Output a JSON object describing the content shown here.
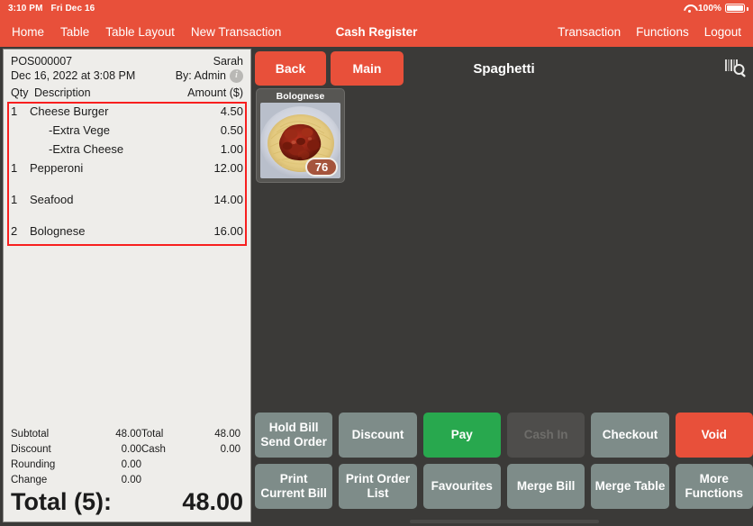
{
  "statusbar": {
    "time": "3:10 PM",
    "date": "Fri Dec 16",
    "battery_percent": "100%",
    "wifi_icon": "wifi-icon",
    "battery_icon": "battery-full-icon"
  },
  "nav": {
    "title": "Cash Register",
    "left_items": [
      {
        "label": "Home"
      },
      {
        "label": "Table"
      },
      {
        "label": "Table Layout"
      },
      {
        "label": "New Transaction"
      }
    ],
    "right_items": [
      {
        "label": "Transaction"
      },
      {
        "label": "Functions"
      },
      {
        "label": "Logout"
      }
    ]
  },
  "receipt": {
    "doc_no": "POS000007",
    "customer": "Sarah",
    "datetime": "Dec 16, 2022 at 3:08 PM",
    "by": "By: Admin",
    "info_icon": "info-icon",
    "col_qty": "Qty",
    "col_desc": "Description",
    "col_amount": "Amount ($)",
    "items": [
      {
        "qty": "1",
        "desc": "Cheese Burger",
        "amount": "4.50",
        "modifier": false,
        "spaced": false
      },
      {
        "qty": "",
        "desc": "-Extra Vege",
        "amount": "0.50",
        "modifier": true,
        "spaced": false
      },
      {
        "qty": "",
        "desc": "-Extra Cheese",
        "amount": "1.00",
        "modifier": true,
        "spaced": false
      },
      {
        "qty": "1",
        "desc": "Pepperoni",
        "amount": "12.00",
        "modifier": false,
        "spaced": true
      },
      {
        "qty": "1",
        "desc": "Seafood",
        "amount": "14.00",
        "modifier": false,
        "spaced": true
      },
      {
        "qty": "2",
        "desc": "Bolognese",
        "amount": "16.00",
        "modifier": false,
        "spaced": true
      }
    ],
    "selection_highlight_color": "#f81f1f",
    "totals_left": [
      {
        "label": "Subtotal",
        "value": "48.00"
      },
      {
        "label": "Discount",
        "value": "0.00"
      },
      {
        "label": "Rounding",
        "value": "0.00"
      },
      {
        "label": "Change",
        "value": "0.00"
      }
    ],
    "totals_right": [
      {
        "label": "Total",
        "value": "48.00"
      },
      {
        "label": "Cash",
        "value": "0.00"
      }
    ],
    "grand_label": "Total (5):",
    "grand_value": "48.00"
  },
  "right_pane": {
    "back_label": "Back",
    "main_label": "Main",
    "category_title": "Spaghetti",
    "scan_icon": "barcode-search-icon",
    "products": [
      {
        "name": "Bolognese",
        "badge": "76",
        "image": "spaghetti-bolognese-photo"
      }
    ],
    "actions_row1": [
      {
        "line1": "Hold Bill",
        "line2": "Send Order",
        "style": "default"
      },
      {
        "line1": "Discount",
        "line2": "",
        "style": "default"
      },
      {
        "line1": "Pay",
        "line2": "",
        "style": "pay"
      },
      {
        "line1": "Cash In",
        "line2": "",
        "style": "disabled"
      },
      {
        "line1": "Checkout",
        "line2": "",
        "style": "default"
      },
      {
        "line1": "Void",
        "line2": "",
        "style": "void"
      }
    ],
    "actions_row2": [
      {
        "line1": "Print",
        "line2": "Current Bill",
        "style": "default"
      },
      {
        "line1": "Print Order",
        "line2": "List",
        "style": "default"
      },
      {
        "line1": "Favourites",
        "line2": "",
        "style": "default"
      },
      {
        "line1": "Merge Bill",
        "line2": "",
        "style": "default"
      },
      {
        "line1": "Merge Table",
        "line2": "",
        "style": "default"
      },
      {
        "line1": "More",
        "line2": "Functions",
        "style": "default"
      }
    ]
  },
  "colors": {
    "accent_red": "#e8503a",
    "background_dark": "#3b3a38",
    "pay_green": "#28a84e",
    "button_gray": "#7e8c89",
    "receipt_paper": "#eeedea"
  }
}
